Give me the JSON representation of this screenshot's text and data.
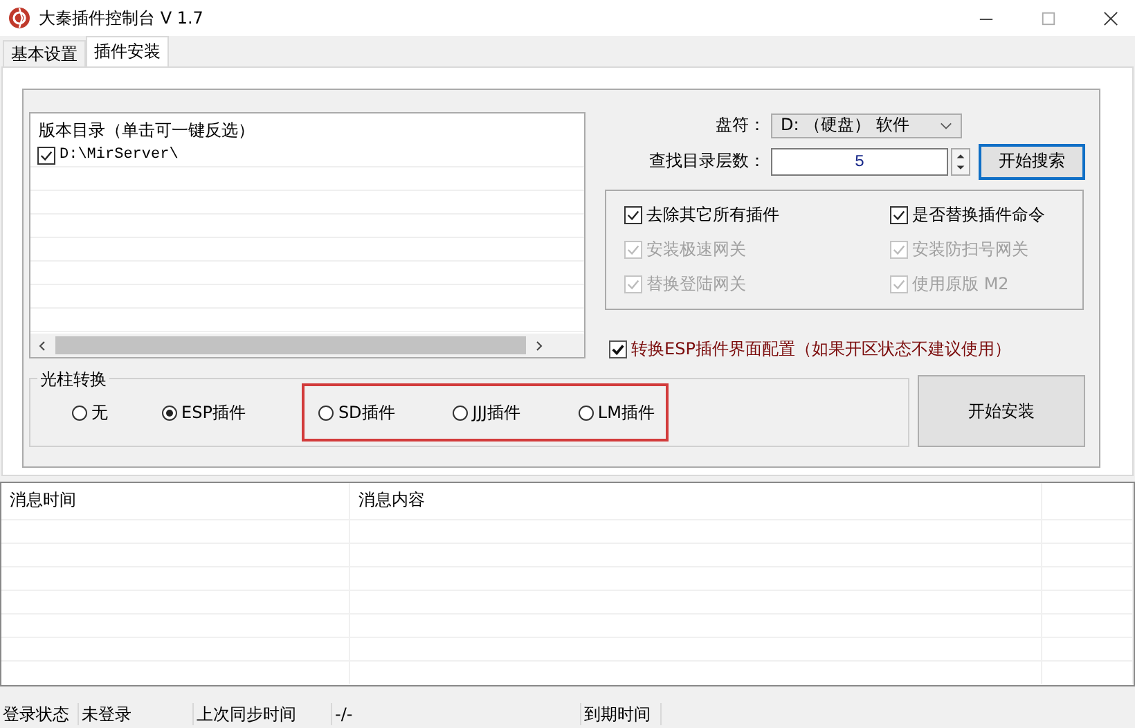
{
  "window": {
    "title": "大秦插件控制台 V 1.7"
  },
  "tabs": [
    {
      "label": "基本设置",
      "selected": false
    },
    {
      "label": "插件安装",
      "selected": true
    }
  ],
  "directory_list": {
    "header": "版本目录（单击可一键反选）",
    "items": [
      {
        "label": "D:\\MirServer\\",
        "checked": true
      }
    ]
  },
  "drive": {
    "label": "盘符：",
    "value": "D: （硬盘） 软件"
  },
  "search_depth": {
    "label": "查找目录层数：",
    "value": "5"
  },
  "search_button": "开始搜索",
  "options": [
    {
      "label": "去除其它所有插件",
      "checked": true,
      "disabled": false
    },
    {
      "label": "是否替换插件命令",
      "checked": true,
      "disabled": false
    },
    {
      "label": "安装极速网关",
      "checked": true,
      "disabled": true
    },
    {
      "label": "安装防扫号网关",
      "checked": true,
      "disabled": true
    },
    {
      "label": "替换登陆网关",
      "checked": true,
      "disabled": true
    },
    {
      "label": "使用原版 M2",
      "checked": true,
      "disabled": true
    }
  ],
  "convert_option": {
    "label": "转换ESP插件界面配置（如果开区状态不建议使用）",
    "checked": true
  },
  "light_pillar": {
    "title": "光柱转换",
    "options": [
      {
        "label": "无",
        "selected": false
      },
      {
        "label": "ESP插件",
        "selected": true
      }
    ],
    "highlighted_options": [
      {
        "label": "SD插件",
        "selected": false
      },
      {
        "label": "JJJ插件",
        "selected": false
      },
      {
        "label": "LM插件",
        "selected": false
      }
    ]
  },
  "install_button": "开始安装",
  "message_log": {
    "columns": [
      "消息时间",
      "消息内容"
    ]
  },
  "status_bar": [
    "登录状态",
    "未登录",
    "上次同步时间",
    "-/-",
    "到期时间"
  ]
}
